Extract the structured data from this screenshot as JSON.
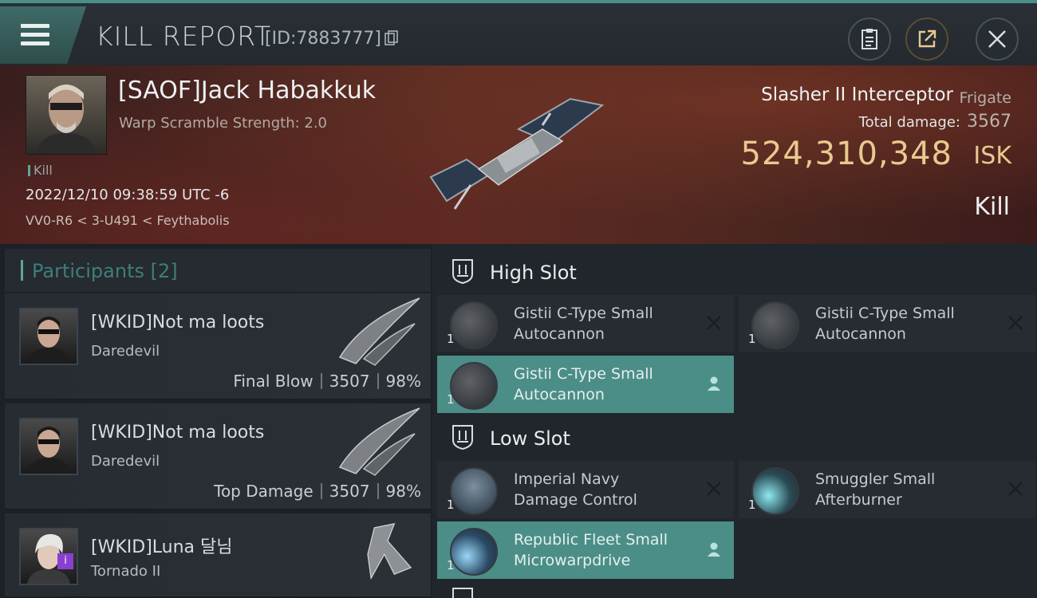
{
  "header": {
    "title": "KILL REPORT",
    "report_id": "[ID:7883777]"
  },
  "victim": {
    "name": "[SAOF]Jack Habakkuk",
    "warp_scramble": "Warp Scramble Strength: 2.0",
    "status_tag": "Kill",
    "datetime": "2022/12/10 09:38:59 UTC -6",
    "location": "VV0-R6 < 3-U491 < Feythabolis",
    "ship_name": "Slasher II Interceptor",
    "ship_class": "Frigate",
    "total_damage_label": "Total damage:",
    "total_damage": "3567",
    "isk_value": "524,310,348",
    "isk_unit": "ISK",
    "outcome": "Kill"
  },
  "participants": {
    "label": "Participants",
    "count": "[2]",
    "list": [
      {
        "name": "[WKID]Not ma loots",
        "ship": "Daredevil",
        "role": "Final Blow",
        "damage": "3507",
        "percent": "98%"
      },
      {
        "name": "[WKID]Not ma loots",
        "ship": "Daredevil",
        "role": "Top Damage",
        "damage": "3507",
        "percent": "98%"
      },
      {
        "name": "[WKID]Luna 달님",
        "ship": "Tornado II",
        "badge": "i"
      }
    ]
  },
  "fitting": {
    "high_slot_label": "High Slot",
    "low_slot_label": "Low Slot",
    "high": [
      {
        "name_line1": "Gistii C-Type Small",
        "name_line2": "Autocannon",
        "qty": "1",
        "state": "destroyed"
      },
      {
        "name_line1": "Gistii C-Type Small",
        "name_line2": "Autocannon",
        "qty": "1",
        "state": "destroyed"
      },
      {
        "name_line1": "Gistii C-Type Small",
        "name_line2": "Autocannon",
        "qty": "1",
        "state": "dropped"
      }
    ],
    "low": [
      {
        "name_line1": "Imperial Navy",
        "name_line2": "Damage Control",
        "qty": "1",
        "state": "destroyed"
      },
      {
        "name_line1": "Smuggler Small",
        "name_line2": "Afterburner",
        "qty": "1",
        "state": "destroyed"
      },
      {
        "name_line1": "Republic Fleet Small",
        "name_line2": "Microwarpdrive",
        "qty": "1",
        "state": "dropped"
      }
    ]
  },
  "icons": {
    "menu": "hamburger-icon",
    "copy": "copy-icon",
    "clipboard": "clipboard-icon",
    "share": "share-icon",
    "close": "close-icon",
    "slot": "slot-shield-icon",
    "destroyed": "x-mark-icon",
    "dropped": "person-icon"
  },
  "colors": {
    "accent": "#4b8e87",
    "isk": "#e9c98f",
    "participants_label": "#3f7e7a"
  }
}
